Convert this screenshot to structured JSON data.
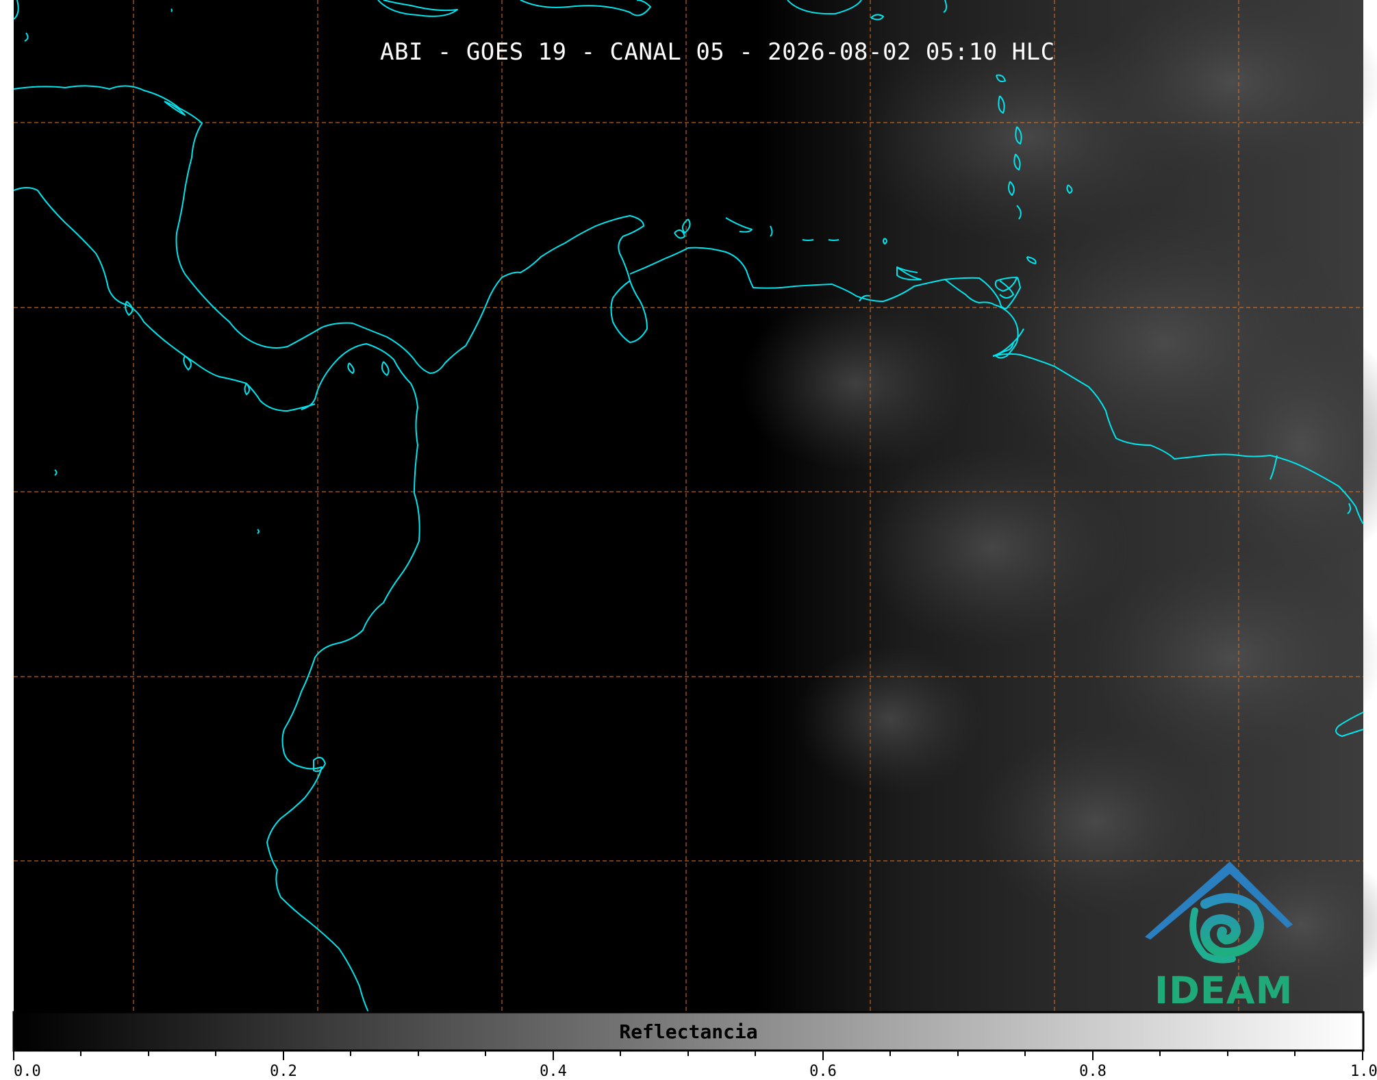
{
  "title": "ABI - GOES 19 - CANAL 05 - 2026-08-02 05:10 HLC",
  "colorbar": {
    "label": "Reflectancia",
    "ticks": [
      "0.0",
      "0.2",
      "0.4",
      "0.6",
      "0.8",
      "1.0"
    ],
    "range": [
      0.0,
      1.0
    ],
    "colormap": "grayscale"
  },
  "map": {
    "background_color": "#000000",
    "coastline_color": "#00e5ee",
    "gridline_color": "#e07020",
    "gridline_style": "dashed",
    "image_type": "visible satellite reflectance, night on left, early dawn on right"
  },
  "logo": {
    "text": "IDEAM",
    "colors": {
      "roof": "#2a7fc0",
      "swirl": "#1faa9a",
      "text": "#1faa7a"
    }
  }
}
